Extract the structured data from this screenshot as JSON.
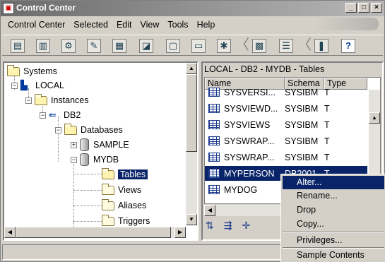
{
  "window": {
    "title": "Control Center"
  },
  "menu": [
    "Control Center",
    "Selected",
    "Edit",
    "View",
    "Tools",
    "Help"
  ],
  "toolbar": {
    "icons": [
      "server-icon",
      "database-icon",
      "tools-icon",
      "script-icon",
      "document-icon",
      "chart-icon",
      "window-icon",
      "command-icon",
      "gear-icon",
      "grid-icon",
      "list-icon",
      "book-icon"
    ],
    "help_label": "?"
  },
  "tree": {
    "systems": "Systems",
    "local": "LOCAL",
    "instances": "Instances",
    "db2": "DB2",
    "databases": "Databases",
    "sample": "SAMPLE",
    "mydb": "MYDB",
    "tables": "Tables",
    "views": "Views",
    "aliases": "Aliases",
    "triggers": "Triggers"
  },
  "list": {
    "title": "LOCAL - DB2 - MYDB - Tables",
    "columns": [
      "Name",
      "Schema",
      "Type"
    ],
    "rows": [
      {
        "name": "SYSVERSI...",
        "schema": "SYSIBM",
        "type": "T"
      },
      {
        "name": "SYSVIEWD...",
        "schema": "SYSIBM",
        "type": "T"
      },
      {
        "name": "SYSVIEWS",
        "schema": "SYSIBM",
        "type": "T"
      },
      {
        "name": "SYSWRAP...",
        "schema": "SYSIBM",
        "type": "T"
      },
      {
        "name": "SYSWRAP...",
        "schema": "SYSIBM",
        "type": "T"
      },
      {
        "name": "MYPERSON",
        "schema": "DB2001",
        "type": "T"
      },
      {
        "name": "MYDOG",
        "schema": "",
        "type": ""
      }
    ]
  },
  "context_menu": {
    "items": [
      "Alter...",
      "Rename...",
      "Drop",
      "Copy...",
      "Privileges...",
      "Sample Contents"
    ]
  },
  "colors": {
    "selection": "#0a246a",
    "face": "#d4d0c8"
  }
}
